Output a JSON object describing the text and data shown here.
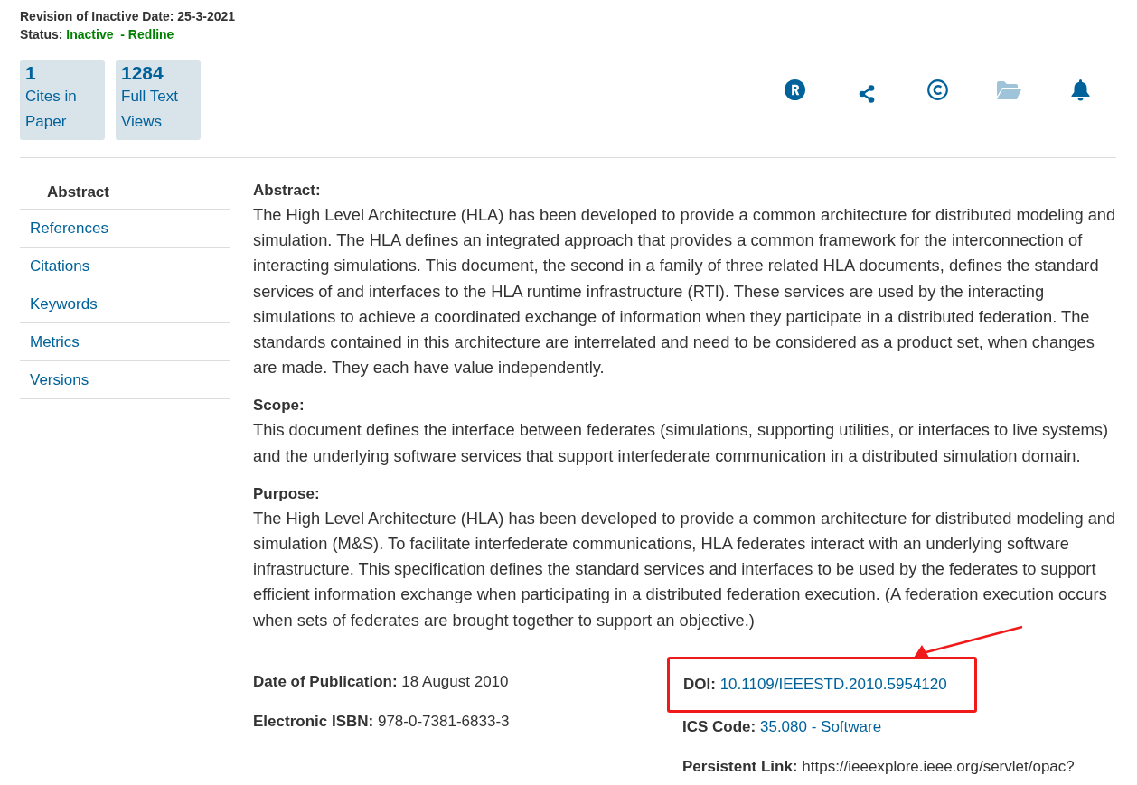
{
  "header": {
    "revision_label": "Revision of Inactive Date:",
    "revision_date": "25-3-2021",
    "status_label": "Status:",
    "status_value": "Inactive",
    "status_extra": "- Redline"
  },
  "metrics": [
    {
      "number": "1",
      "label": "Cites in Paper"
    },
    {
      "number": "1284",
      "label": "Full Text Views"
    }
  ],
  "actions": [
    {
      "kind": "registered",
      "muted": false
    },
    {
      "kind": "share",
      "muted": false
    },
    {
      "kind": "copyright",
      "muted": false
    },
    {
      "kind": "folder",
      "muted": true
    },
    {
      "kind": "bell",
      "muted": false
    }
  ],
  "sidebar": {
    "items": [
      {
        "label": "Abstract",
        "selected": true
      },
      {
        "label": "References",
        "selected": false
      },
      {
        "label": "Citations",
        "selected": false
      },
      {
        "label": "Keywords",
        "selected": false
      },
      {
        "label": "Metrics",
        "selected": false
      },
      {
        "label": "Versions",
        "selected": false
      }
    ]
  },
  "sections": [
    {
      "title": "Abstract:",
      "text": "The High Level Architecture (HLA) has been developed to provide a common architecture for distributed modeling and simulation. The HLA defines an integrated approach that provides a common framework for the interconnection of interacting simulations. This document, the second in a family of three related HLA documents, defines the standard services of and interfaces to the HLA runtime infrastructure (RTI). These services are used by the interacting simulations to achieve a coordinated exchange of information when they participate in a distributed federation. The standards contained in this architecture are interrelated and need to be considered as a product set, when changes are made. They each have value independently."
    },
    {
      "title": "Scope:",
      "text": "This document defines the interface between federates (simulations, supporting utilities, or interfaces to live systems) and the underlying software services that support interfederate communication in a distributed simulation domain."
    },
    {
      "title": "Purpose:",
      "text": "The High Level Architecture (HLA) has been developed to provide a common architecture for distributed modeling and simulation (M&S). To facilitate interfederate communications, HLA federates interact with an underlying software infrastructure. This specification defines the standard services and interfaces to be used by the federates to support efficient information exchange when participating in a distributed federation execution. (A federation execution occurs when sets of federates are brought together to support an objective.)"
    }
  ],
  "details": {
    "left": [
      {
        "label": "Date of Publication:",
        "value": "18 August 2010",
        "kind": "text",
        "highlighted": false
      },
      {
        "label": "Electronic ISBN:",
        "value": "978-0-7381-6833-3",
        "kind": "text",
        "highlighted": false
      }
    ],
    "right": [
      {
        "label": "DOI:",
        "value": "10.1109/IEEESTD.2010.5954120",
        "kind": "link",
        "highlighted": true
      },
      {
        "label": "ICS Code:",
        "value": "35.080 - Software",
        "kind": "link",
        "highlighted": false
      },
      {
        "label": "Persistent Link:",
        "value": "https://ieeexplore.ieee.org/servlet/opac?",
        "kind": "text",
        "highlighted": false
      }
    ]
  }
}
